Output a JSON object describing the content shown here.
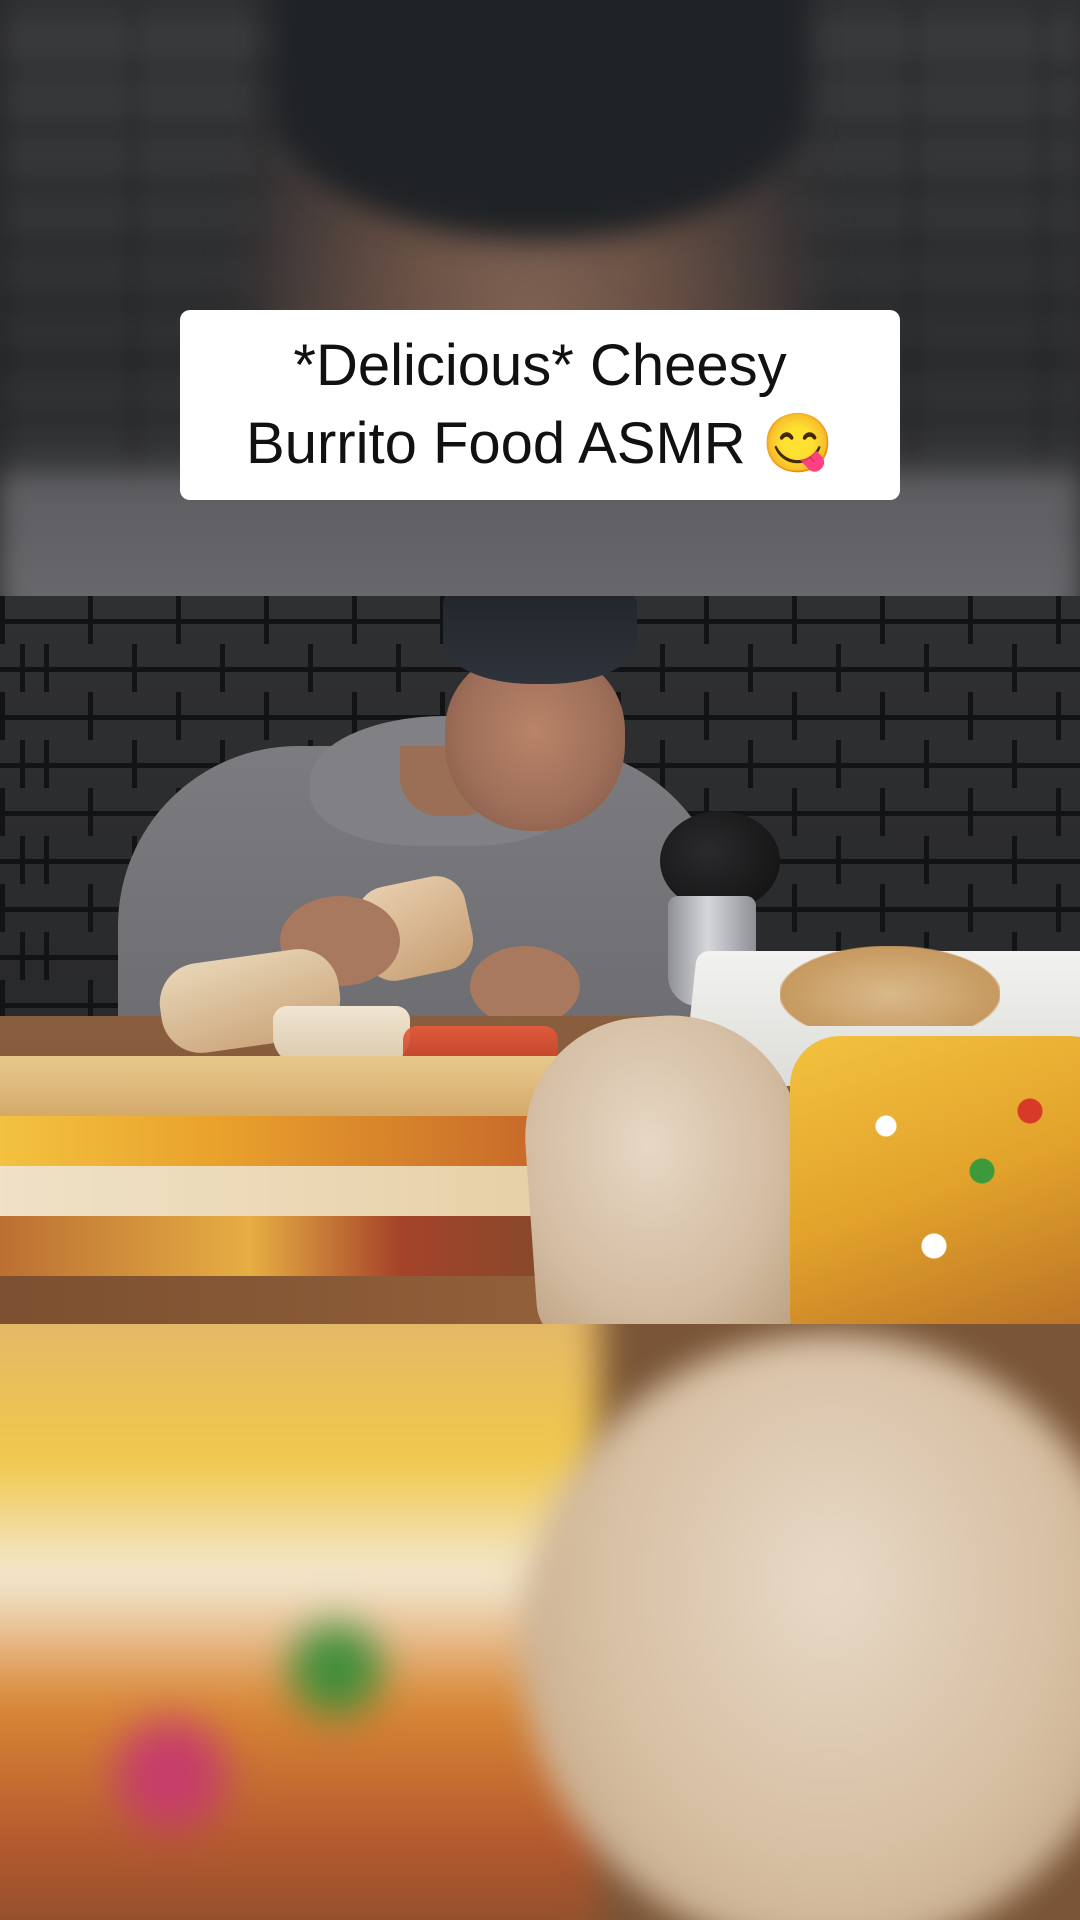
{
  "title_card": {
    "text": "*Delicious* Cheesy\nBurrito Food ASMR 😋"
  },
  "colors": {
    "card_background": "#ffffff",
    "card_text": "#111111",
    "brick_wall": "#2b2c2e"
  }
}
